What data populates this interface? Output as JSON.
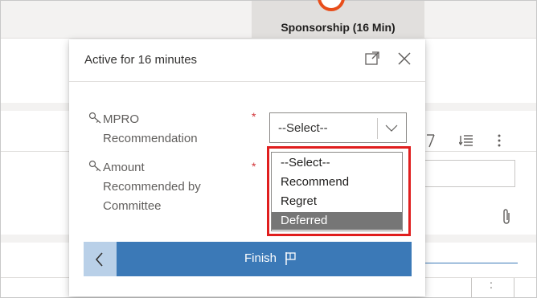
{
  "stage": {
    "label": "Sponsorship  (16 Min)",
    "ring_color": "#e84e1b"
  },
  "flyout": {
    "title": "Active for 16 minutes",
    "expand_icon": "expand-icon",
    "close_icon": "close-icon",
    "fields": [
      {
        "label_line1": "MPRO",
        "label_line2": "Recommendation",
        "required_mark": "*"
      },
      {
        "label_line1": "Amount",
        "label_line2": "Recommended by",
        "label_line3": "Committee",
        "required_mark": "*"
      }
    ],
    "select": {
      "value": "--Select--"
    },
    "dropdown_options": [
      "--Select--",
      "Recommend",
      "Regret",
      "Deferred"
    ],
    "highlighted_option": "Deferred",
    "finish": {
      "label": "Finish"
    }
  },
  "background": {
    "toolbar_icons": [
      "filter-icon",
      "sort-list-icon",
      "more-vertical-icon"
    ],
    "attachment_icon": "paperclip-icon",
    "bottom_dots": ":"
  },
  "colors": {
    "accent": "#3b79b7",
    "accent_light": "#b9d0e8",
    "highlight": "#e01e1e",
    "required": "#d13438"
  }
}
